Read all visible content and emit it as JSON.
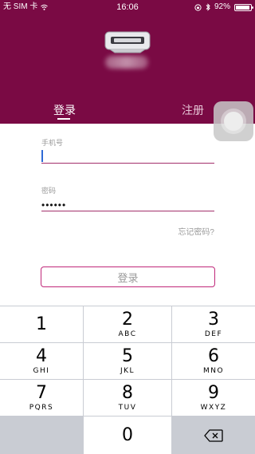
{
  "status_bar": {
    "carrier": "无 SIM 卡",
    "time": "16:06",
    "battery": "92%",
    "battery_level": 0.92
  },
  "tabs": {
    "login": "登录",
    "register": "注册"
  },
  "form": {
    "phone_label": "手机号",
    "password_label": "密码",
    "password_value": "••••••",
    "forgot_link": "忘记密码?",
    "login_button": "登录"
  },
  "keypad": {
    "keys": [
      {
        "num": "1",
        "letters": ""
      },
      {
        "num": "2",
        "letters": "ABC"
      },
      {
        "num": "3",
        "letters": "DEF"
      },
      {
        "num": "4",
        "letters": "GHI"
      },
      {
        "num": "5",
        "letters": "JKL"
      },
      {
        "num": "6",
        "letters": "MNO"
      },
      {
        "num": "7",
        "letters": "PQRS"
      },
      {
        "num": "8",
        "letters": "TUV"
      },
      {
        "num": "9",
        "letters": "WXYZ"
      },
      {
        "num": "0",
        "letters": ""
      }
    ]
  },
  "colors": {
    "header": "#7a0a44",
    "accent": "#c0287a",
    "keypad_bg": "#c9ccd3"
  }
}
